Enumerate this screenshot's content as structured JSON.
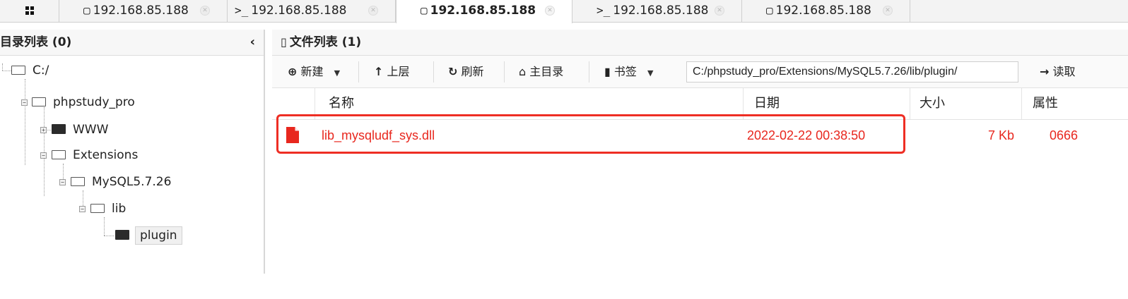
{
  "tabs": [
    {
      "icon": "folder-outline-icon",
      "icon_glyph": "▢",
      "label": "192.168.85.188",
      "active": false
    },
    {
      "icon": "terminal-icon",
      "icon_glyph": ">_",
      "label": "192.168.85.188",
      "active": false
    },
    {
      "icon": "folder-outline-icon",
      "icon_glyph": "▢",
      "label": "192.168.85.188",
      "active": true
    },
    {
      "icon": "terminal-icon",
      "icon_glyph": ">_",
      "label": "192.168.85.188",
      "active": false
    },
    {
      "icon": "folder-outline-icon",
      "icon_glyph": "▢",
      "label": "192.168.85.188",
      "active": false
    }
  ],
  "tab_close_glyph": "✕",
  "dir_panel": {
    "title": "目录列表 (0)",
    "collapse_glyph": "‹",
    "tree": [
      {
        "label": "C:/",
        "icon": "folder-open-icon"
      },
      {
        "label": "phpstudy_pro",
        "icon": "folder-open-icon"
      },
      {
        "label": "WWW",
        "icon": "folder-closed-icon"
      },
      {
        "label": "Extensions",
        "icon": "folder-open-icon"
      },
      {
        "label": "MySQL5.7.26",
        "icon": "folder-open-icon"
      },
      {
        "label": "lib",
        "icon": "folder-open-icon"
      },
      {
        "label": "plugin",
        "icon": "folder-closed-icon",
        "selected": true
      }
    ]
  },
  "file_panel": {
    "title": "文件列表 (1)",
    "toolbar": {
      "new_label": "新建",
      "up_label": "上层",
      "refresh_label": "刷新",
      "home_label": "主目录",
      "bookmark_label": "书签",
      "path_value": "C:/phpstudy_pro/Extensions/MySQL5.7.26/lib/plugin/",
      "read_label": "读取"
    },
    "columns": {
      "name": "名称",
      "date": "日期",
      "size": "大小",
      "attr": "属性"
    },
    "files": [
      {
        "name": "lib_mysqludf_sys.dll",
        "date": "2022-02-22 00:38:50",
        "size": "7 Kb",
        "attr": "0666"
      }
    ]
  },
  "colors": {
    "highlight": "#ee2e24",
    "file_text": "#e8271e"
  }
}
